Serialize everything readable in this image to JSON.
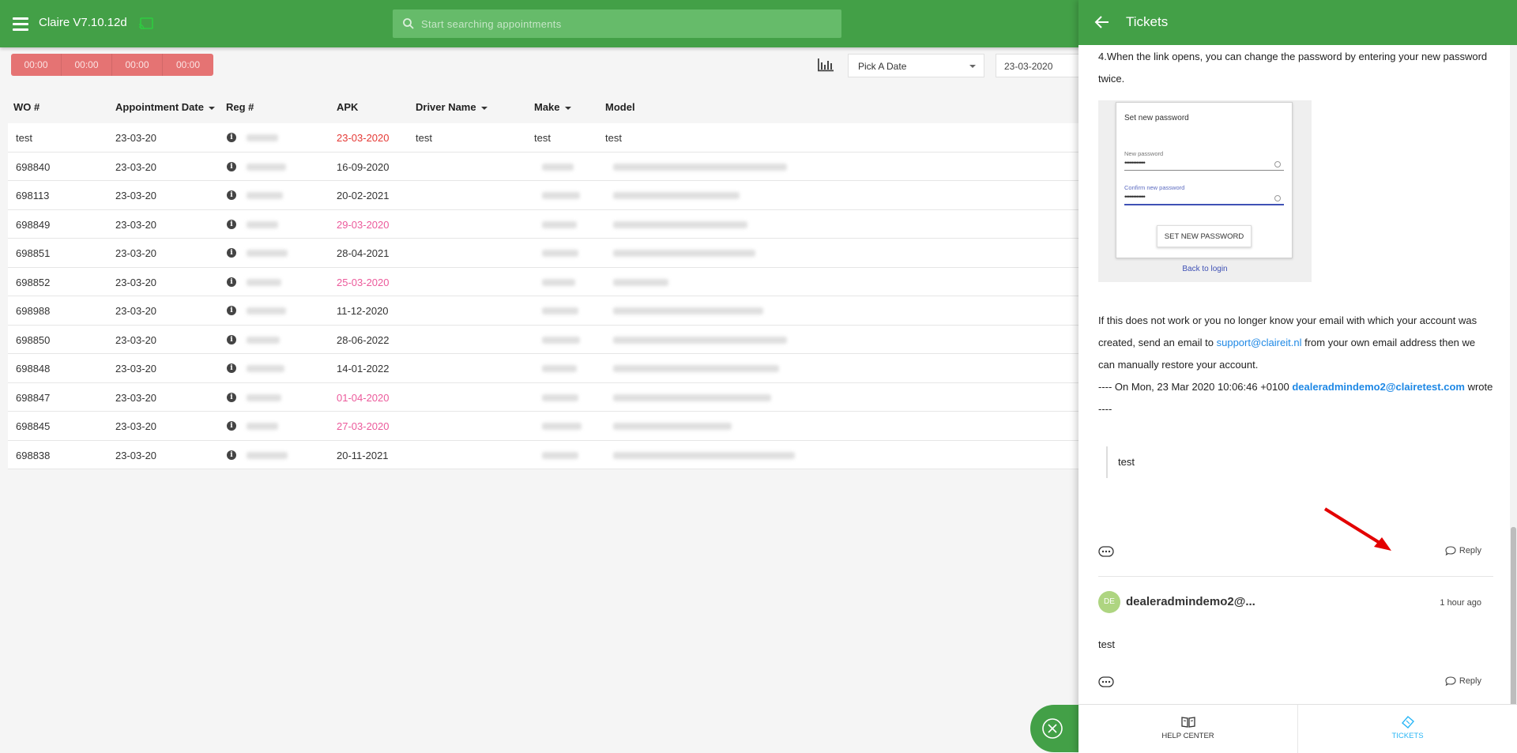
{
  "app": {
    "title": "Claire V7.10.12d",
    "menu_icon": "hamburger-menu-icon",
    "cast_icon": "cast-icon"
  },
  "search": {
    "placeholder": "Start searching appointments",
    "value": ""
  },
  "toolbar": {
    "timers": [
      "00:00",
      "00:00",
      "00:00",
      "00:00"
    ],
    "stats_icon": "bar-chart-icon",
    "date_picker_label": "Pick A Date",
    "date_value": "23-03-2020"
  },
  "table": {
    "columns": {
      "wo": "WO #",
      "appointment_date": "Appointment Date",
      "reg": "Reg #",
      "apk": "APK",
      "driver": "Driver Name",
      "make": "Make",
      "model": "Model"
    },
    "rows": [
      {
        "wo": "test",
        "date": "23-03-20",
        "apk": "23-03-2020",
        "apk_status": "red",
        "driver": "test",
        "make": "test",
        "model": "test"
      },
      {
        "wo": "698840",
        "date": "23-03-20",
        "apk": "16-09-2020",
        "apk_status": "normal",
        "driver": "",
        "make": "",
        "model": ""
      },
      {
        "wo": "698113",
        "date": "23-03-20",
        "apk": "20-02-2021",
        "apk_status": "normal",
        "driver": "",
        "make": "",
        "model": ""
      },
      {
        "wo": "698849",
        "date": "23-03-20",
        "apk": "29-03-2020",
        "apk_status": "pink",
        "driver": "",
        "make": "",
        "model": ""
      },
      {
        "wo": "698851",
        "date": "23-03-20",
        "apk": "28-04-2021",
        "apk_status": "normal",
        "driver": "",
        "make": "",
        "model": ""
      },
      {
        "wo": "698852",
        "date": "23-03-20",
        "apk": "25-03-2020",
        "apk_status": "pink",
        "driver": "",
        "make": "",
        "model": ""
      },
      {
        "wo": "698988",
        "date": "23-03-20",
        "apk": "11-12-2020",
        "apk_status": "normal",
        "driver": "",
        "make": "",
        "model": ""
      },
      {
        "wo": "698850",
        "date": "23-03-20",
        "apk": "28-06-2022",
        "apk_status": "normal",
        "driver": "",
        "make": "",
        "model": ""
      },
      {
        "wo": "698848",
        "date": "23-03-20",
        "apk": "14-01-2022",
        "apk_status": "normal",
        "driver": "",
        "make": "",
        "model": ""
      },
      {
        "wo": "698847",
        "date": "23-03-20",
        "apk": "01-04-2020",
        "apk_status": "pink",
        "driver": "",
        "make": "",
        "model": ""
      },
      {
        "wo": "698845",
        "date": "23-03-20",
        "apk": "27-03-2020",
        "apk_status": "pink",
        "driver": "",
        "make": "",
        "model": ""
      },
      {
        "wo": "698838",
        "date": "23-03-20",
        "apk": "20-11-2021",
        "apk_status": "normal",
        "driver": "",
        "make": "",
        "model": ""
      }
    ]
  },
  "tickets": {
    "title": "Tickets",
    "step4": "4.When the link opens, you can change the password by entering your new password twice.",
    "screenshot": {
      "title": "Set new password",
      "new_password_label": "New password",
      "confirm_password_label": "Confirm new password",
      "masked_value": "••••••••••••",
      "button": "SET NEW PASSWORD",
      "back_link": "Back to login"
    },
    "fallback_part1": "If this does not work or you no longer know your email with which your account was created, send an email to",
    "support_email": "support@claireit.nl",
    "fallback_part2": "from your own email address then we can manually restore your account.",
    "quoted_header_prefix": "---- On  Mon, 23 Mar 2020 10:06:46 +0100",
    "quoted_sender": "dealeradmindemo2@clairetest.com",
    "quoted_header_suffix": "wrote ----",
    "quoted_text": "test",
    "reply_label": "Reply",
    "comment": {
      "avatar_initials": "DE",
      "author": "dealeradmindemo2@...",
      "time": "1 hour ago",
      "text": "test",
      "reply_label": "Reply"
    },
    "footer": {
      "help_center": "HELP CENTER",
      "tickets": "TICKETS",
      "active_tab": "tickets"
    }
  },
  "colors": {
    "brand_green": "#43a047",
    "timer_red": "#e57373",
    "apk_red": "#e53935",
    "apk_pink": "#ec5a9b",
    "link_blue": "#1e88e5",
    "active_tab": "#29b6f6"
  }
}
